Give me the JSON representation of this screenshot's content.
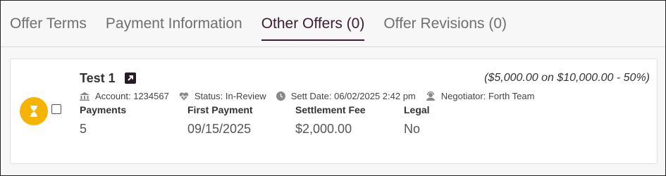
{
  "tabs": [
    {
      "label": "Offer Terms"
    },
    {
      "label": "Payment Information"
    },
    {
      "label": "Other Offers (0)"
    },
    {
      "label": "Offer Revisions (0)"
    }
  ],
  "active_tab": "Other Offers (0)",
  "colors": {
    "accent": "#3b1d33",
    "status": "#f6b300"
  },
  "offer": {
    "name": "Test 1",
    "summary": "($5,000.00 on $10,000.00 - 50%)",
    "status_icon": "hourglass-icon",
    "meta": {
      "account": "Account: 1234567",
      "status": "Status: In-Review",
      "sett_date": "Sett Date: 06/02/2025 2:42 pm",
      "negotiator": "Negotiator: Forth Team"
    },
    "columns": [
      {
        "label": "Payments",
        "value": "5"
      },
      {
        "label": "First Payment",
        "value": "09/15/2025"
      },
      {
        "label": "Settlement Fee",
        "value": "$2,000.00"
      },
      {
        "label": "Legal",
        "value": "No"
      }
    ]
  }
}
